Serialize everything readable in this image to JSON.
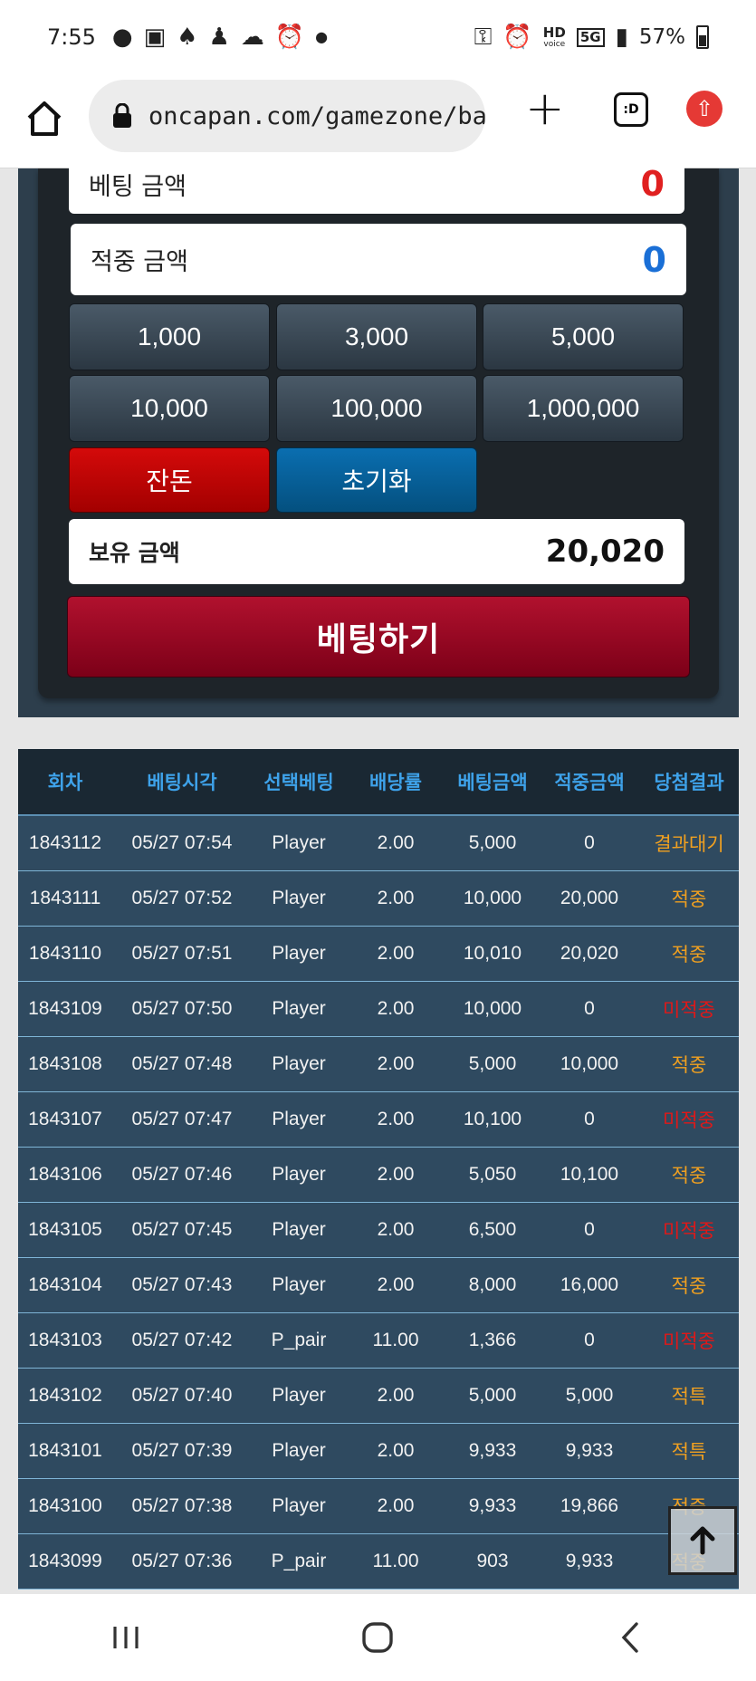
{
  "status_bar": {
    "time": "7:55",
    "battery": "57%",
    "hd_label": "HD",
    "voice_label": "voice",
    "net_label": "5G"
  },
  "browser": {
    "url": "oncapan.com/gamezone/ba",
    "tab_count": ":D"
  },
  "bet_panel": {
    "bet_amount_label": "베팅 금액",
    "bet_amount_value": "0",
    "win_amount_label": "적중 금액",
    "win_amount_value": "0",
    "chips": [
      "1,000",
      "3,000",
      "5,000",
      "10,000",
      "100,000",
      "1,000,000"
    ],
    "change_label": "잔돈",
    "reset_label": "초기화",
    "balance_label": "보유 금액",
    "balance_value": "20,020",
    "bet_button_label": "베팅하기",
    "colors": {
      "red_value": "#e02020",
      "blue_value": "#1a6fd6"
    }
  },
  "history": {
    "headers": [
      "회차",
      "베팅시각",
      "선택베팅",
      "배당률",
      "베팅금액",
      "적중금액",
      "당첨결과"
    ],
    "rows": [
      [
        "1843112",
        "05/27 07:54",
        "Player",
        "2.00",
        "5,000",
        "0",
        "결과대기"
      ],
      [
        "1843111",
        "05/27 07:52",
        "Player",
        "2.00",
        "10,000",
        "20,000",
        "적중"
      ],
      [
        "1843110",
        "05/27 07:51",
        "Player",
        "2.00",
        "10,010",
        "20,020",
        "적중"
      ],
      [
        "1843109",
        "05/27 07:50",
        "Player",
        "2.00",
        "10,000",
        "0",
        "미적중"
      ],
      [
        "1843108",
        "05/27 07:48",
        "Player",
        "2.00",
        "5,000",
        "10,000",
        "적중"
      ],
      [
        "1843107",
        "05/27 07:47",
        "Player",
        "2.00",
        "10,100",
        "0",
        "미적중"
      ],
      [
        "1843106",
        "05/27 07:46",
        "Player",
        "2.00",
        "5,050",
        "10,100",
        "적중"
      ],
      [
        "1843105",
        "05/27 07:45",
        "Player",
        "2.00",
        "6,500",
        "0",
        "미적중"
      ],
      [
        "1843104",
        "05/27 07:43",
        "Player",
        "2.00",
        "8,000",
        "16,000",
        "적중"
      ],
      [
        "1843103",
        "05/27 07:42",
        "P_pair",
        "11.00",
        "1,366",
        "0",
        "미적중"
      ],
      [
        "1843102",
        "05/27 07:40",
        "Player",
        "2.00",
        "5,000",
        "5,000",
        "적특"
      ],
      [
        "1843101",
        "05/27 07:39",
        "Player",
        "2.00",
        "9,933",
        "9,933",
        "적특"
      ],
      [
        "1843100",
        "05/27 07:38",
        "Player",
        "2.00",
        "9,933",
        "19,866",
        "적중"
      ],
      [
        "1843099",
        "05/27 07:36",
        "P_pair",
        "11.00",
        "903",
        "9,933",
        "적중"
      ]
    ]
  }
}
